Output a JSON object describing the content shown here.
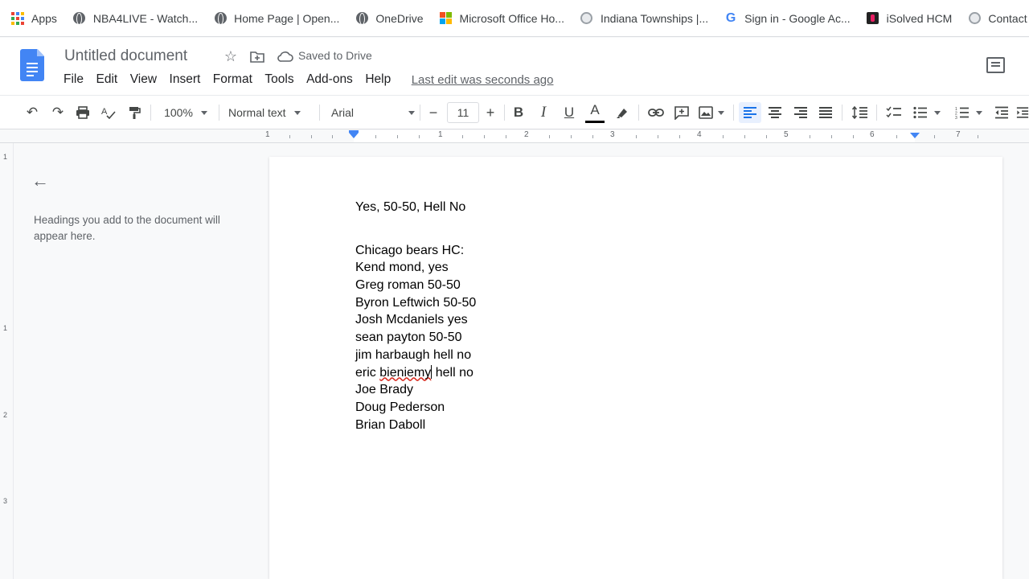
{
  "bookmarks": [
    {
      "label": "Apps",
      "icon": "apps-grid-icon"
    },
    {
      "label": "NBA4LIVE - Watch...",
      "icon": "globe-icon"
    },
    {
      "label": "Home Page | Open...",
      "icon": "globe-icon"
    },
    {
      "label": "OneDrive",
      "icon": "globe-icon"
    },
    {
      "label": "Microsoft Office Ho...",
      "icon": "microsoft-logo-icon"
    },
    {
      "label": "Indiana Townships |...",
      "icon": "seal-icon"
    },
    {
      "label": "Sign in - Google Ac...",
      "icon": "google-logo-icon"
    },
    {
      "label": "iSolved HCM",
      "icon": "isolved-logo-icon"
    },
    {
      "label": "Contact - The Of...",
      "icon": "seal-icon"
    }
  ],
  "document": {
    "title": "Untitled document",
    "save_status": "Saved to Drive",
    "last_edit": "Last edit was seconds ago"
  },
  "menu": [
    "File",
    "Edit",
    "View",
    "Insert",
    "Format",
    "Tools",
    "Add-ons",
    "Help"
  ],
  "toolbar": {
    "zoom": "100%",
    "style": "Normal text",
    "font": "Arial",
    "font_size": "11",
    "minus": "−",
    "plus": "+",
    "bold": "B",
    "italic": "I",
    "underline": "U",
    "text_color": "A"
  },
  "ruler": {
    "numbers": [
      "1",
      "1",
      "2",
      "3",
      "4",
      "5",
      "6",
      "7"
    ]
  },
  "vertical_ruler": {
    "numbers": [
      "1",
      "1",
      "2",
      "3"
    ]
  },
  "outline": {
    "hint": "Headings you add to the document will appear here."
  },
  "content": {
    "line1": "Yes, 50-50, Hell No",
    "line2": "Chicago bears HC:",
    "line3": "Kend mond, yes",
    "line4": "Greg roman 50-50",
    "line5": "Byron Leftwich 50-50",
    "line6": "Josh Mcdaniels yes",
    "line7": "sean payton 50-50",
    "line8": "jim harbaugh hell no",
    "line9_a": "eric ",
    "line9_misspelled": "bieniemy",
    "line9_b": " hell no",
    "line10": "Joe Brady",
    "line11": "Doug Pederson",
    "line12": "Brian Daboll"
  },
  "colors": {
    "accent": "#1a73e8",
    "docs_blue": "#4285f4",
    "spell_error": "#d93025"
  }
}
